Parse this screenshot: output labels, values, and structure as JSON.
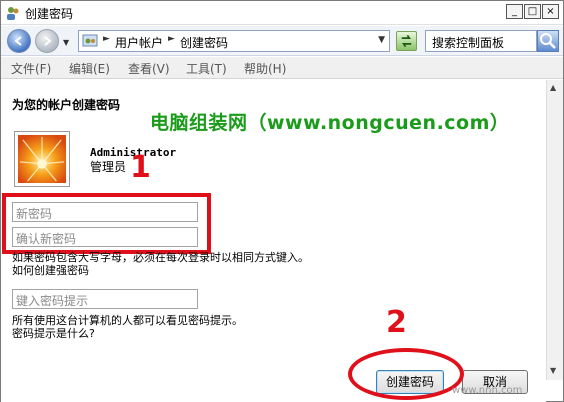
{
  "window": {
    "title": "创建密码",
    "buttons": {
      "minimize": "_",
      "maximize": "□",
      "close": "×"
    }
  },
  "address": {
    "crumbs": [
      "用户帐户",
      "创建密码"
    ],
    "search_placeholder": "搜索控制面板"
  },
  "menu": [
    "文件(F)",
    "编辑(E)",
    "查看(V)",
    "工具(T)",
    "帮助(H)"
  ],
  "page": {
    "heading": "为您的帐户创建密码",
    "watermark": "电脑组装网（www.nongcuen.com）",
    "user_name": "Administrator",
    "user_role": "管理员",
    "new_password_placeholder": "新密码",
    "confirm_password_placeholder": "确认新密码",
    "case_note": "如果密码包含大写字母，必须在每次登录时以相同方式键入。",
    "strong_password_link": "如何创建强密码",
    "hint_placeholder": "键入密码提示",
    "hint_note": "所有使用这台计算机的人都可以看见密码提示。",
    "hint_help_link": "密码提示是什么?"
  },
  "annotations": {
    "step1": "1",
    "step2": "2"
  },
  "buttons": {
    "create": "创建密码",
    "cancel": "取消"
  },
  "corner_watermark": "www.nnn.com",
  "colors": {
    "annotation_red": "#e0101b",
    "watermark_green": "#1a9b1a"
  }
}
